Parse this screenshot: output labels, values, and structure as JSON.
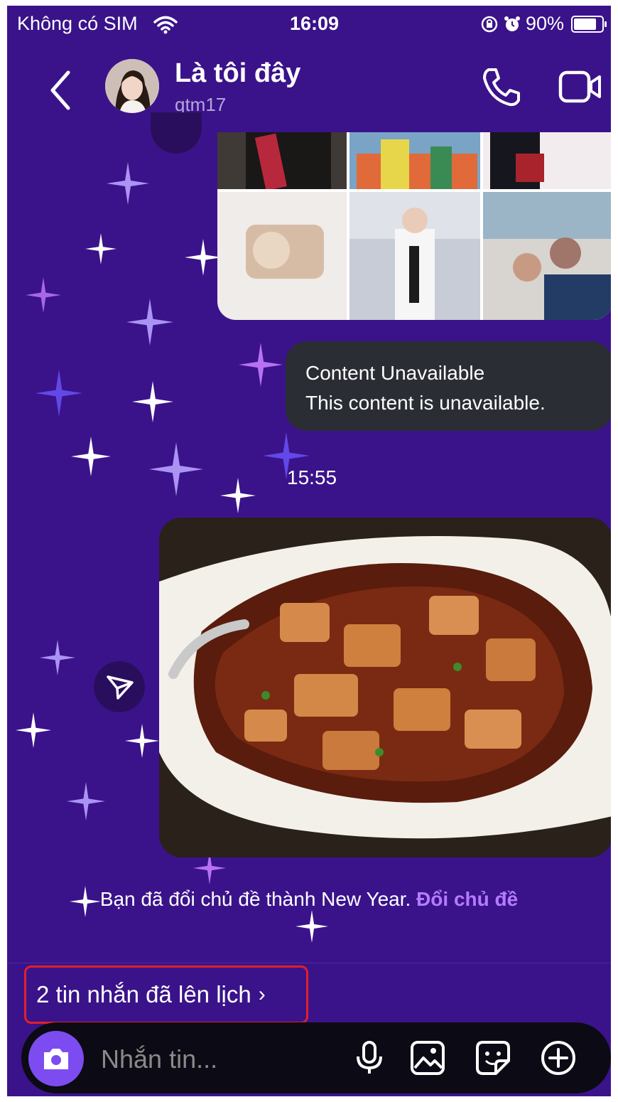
{
  "status_bar": {
    "carrier": "Không có SIM",
    "time": "16:09",
    "battery": "90%",
    "battery_level": 0.9
  },
  "header": {
    "name": "Là tôi đây",
    "username": "qtm17",
    "icons": [
      "back-icon",
      "avatar",
      "phone-icon",
      "video-camera-icon"
    ]
  },
  "messages": {
    "unavailable_title": "Content Unavailable",
    "unavailable_body": "This content is unavailable.",
    "timestamp": "15:55",
    "system_text": "Bạn đã đổi chủ đề thành New Year.",
    "system_link": "Đổi chủ đề"
  },
  "scheduled": {
    "label": "2 tin nhắn đã lên lịch",
    "chevron": "›"
  },
  "composer": {
    "placeholder": "Nhắn tin...",
    "icons": [
      "camera-icon",
      "microphone-icon",
      "image-icon",
      "sticker-icon",
      "plus-icon"
    ]
  },
  "colors": {
    "background": "#3a138a",
    "bubble": "#2b2d34",
    "link": "#b57bff",
    "highlight": "#e0202a",
    "camera_button": "#7d4cf0"
  }
}
